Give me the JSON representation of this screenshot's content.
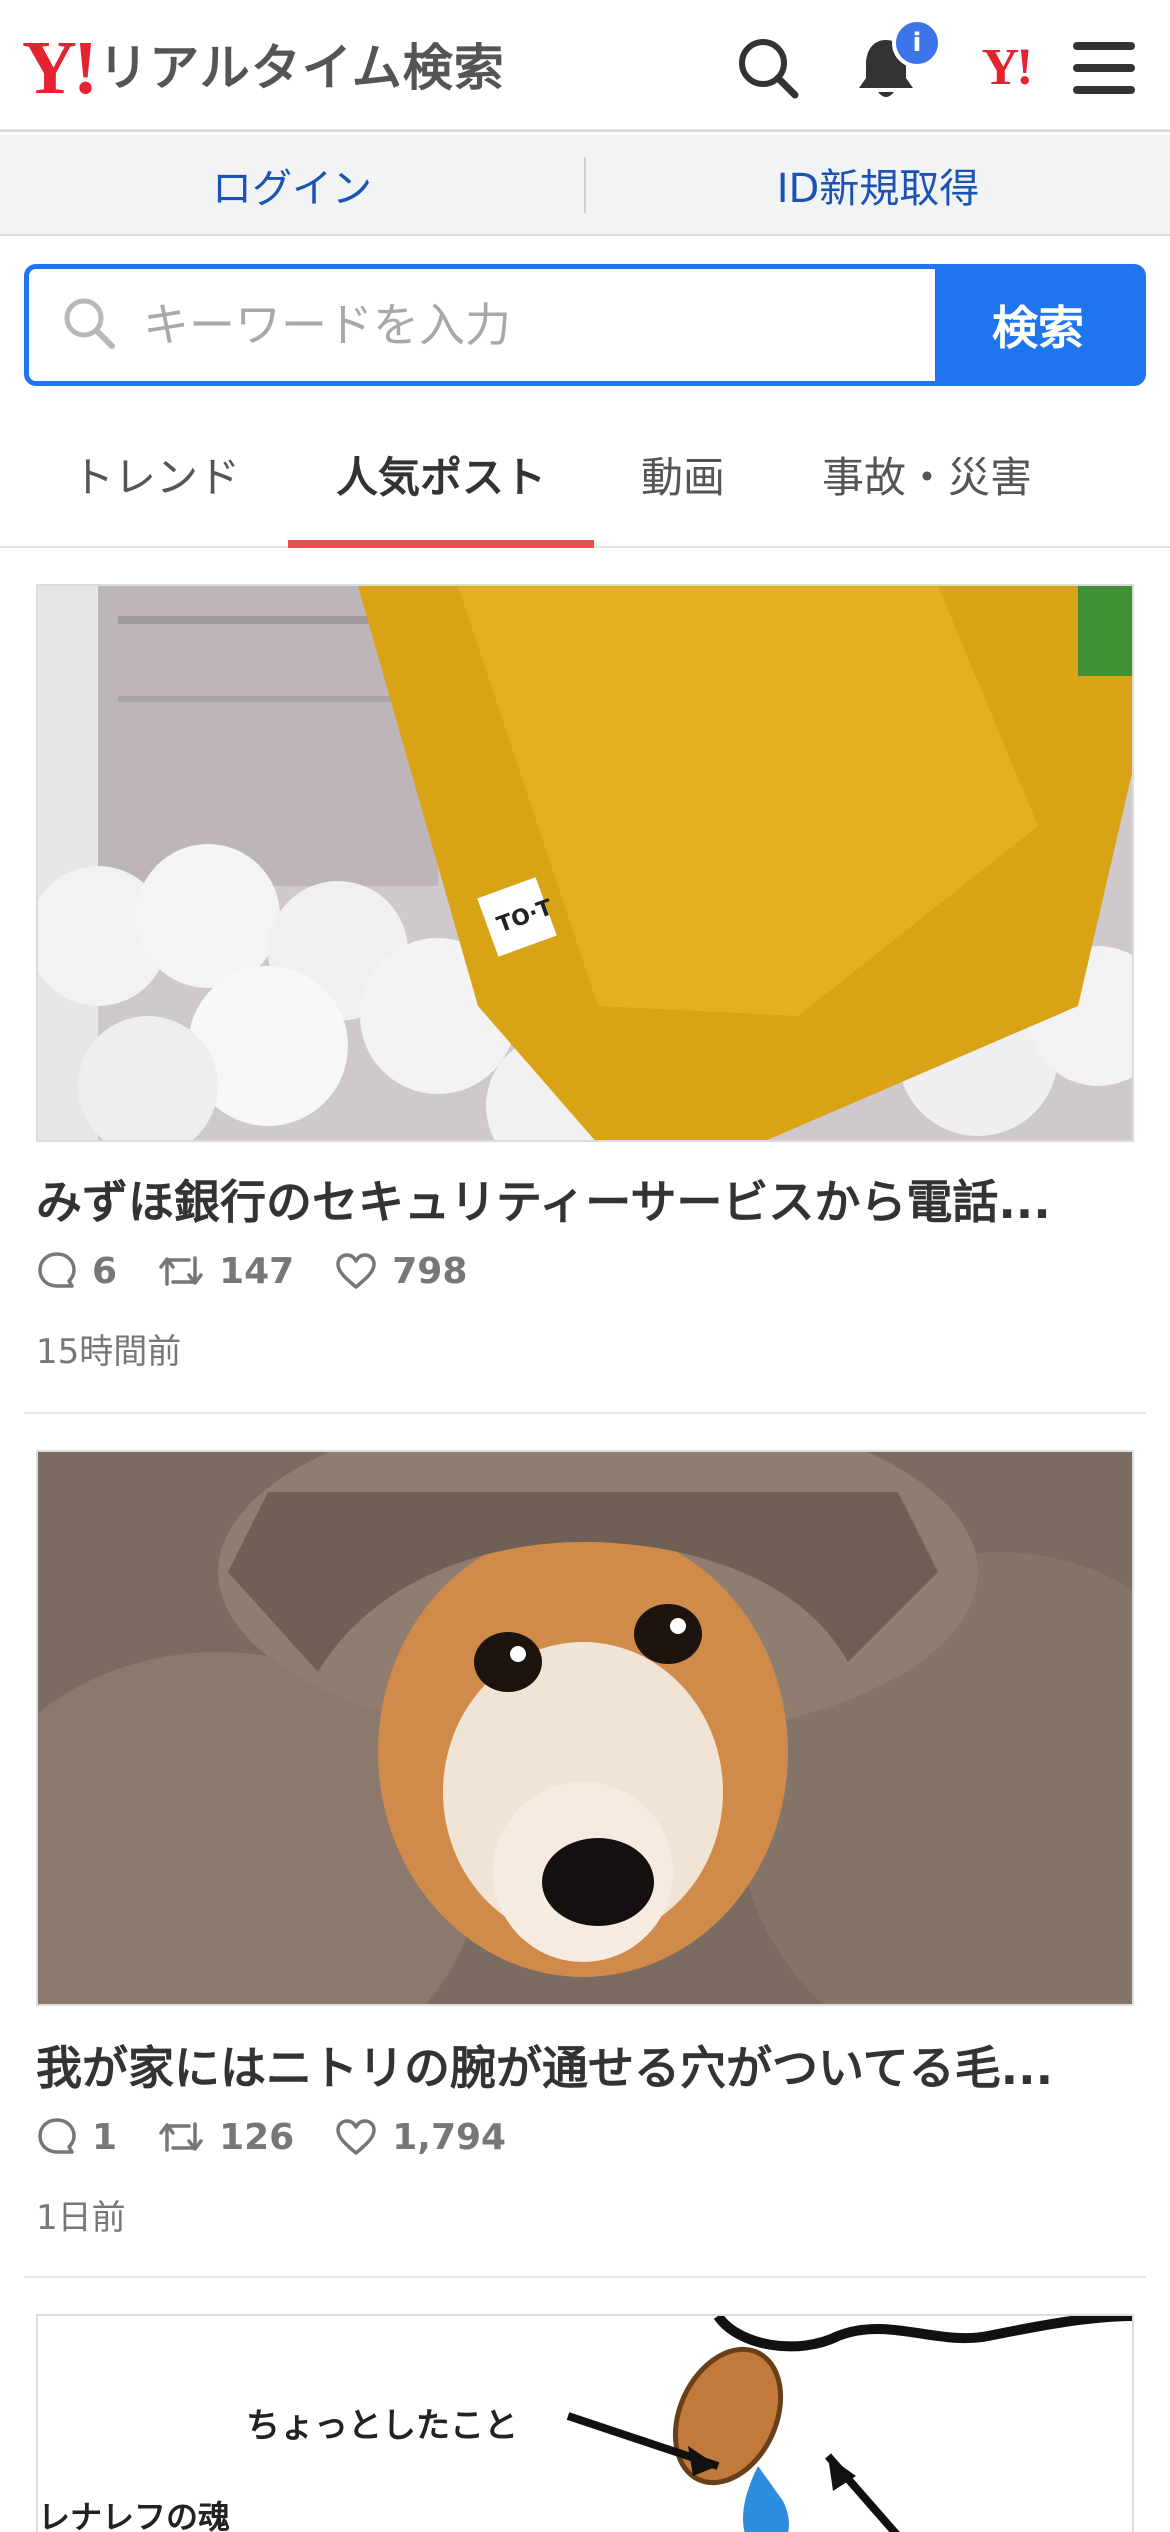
{
  "header": {
    "logo_y": "Y!",
    "logo_text": "リアルタイム検索",
    "notification_badge": "i",
    "yahoo_link": "Y!"
  },
  "loginbar": {
    "login_label": "ログイン",
    "signup_label": "ID新規取得"
  },
  "search": {
    "placeholder": "キーワードを入力",
    "button_label": "検索"
  },
  "tabs": [
    {
      "label": "トレンド",
      "active": false
    },
    {
      "label": "人気ポスト",
      "active": true
    },
    {
      "label": "動画",
      "active": false
    },
    {
      "label": "事故・災害",
      "active": false
    }
  ],
  "posts": [
    {
      "title": "みずほ銀行のセキュリティーサービスから電話...",
      "replies": "6",
      "reposts": "147",
      "likes": "798",
      "time": "15時間前"
    },
    {
      "title": "我が家にはニトリの腕が通せる穴がついてる毛...",
      "replies": "1",
      "reposts": "126",
      "likes": "1,794",
      "time": "1日前"
    },
    {
      "image_text_1": "ちょっとしたこと",
      "image_text_2": "レナレフの魂"
    }
  ],
  "colors": {
    "brand_red": "#e5222f",
    "accent_blue": "#1e75ef",
    "link_blue": "#1b53b4",
    "tab_underline": "#e4514f",
    "badge_blue": "#3d74e8"
  }
}
